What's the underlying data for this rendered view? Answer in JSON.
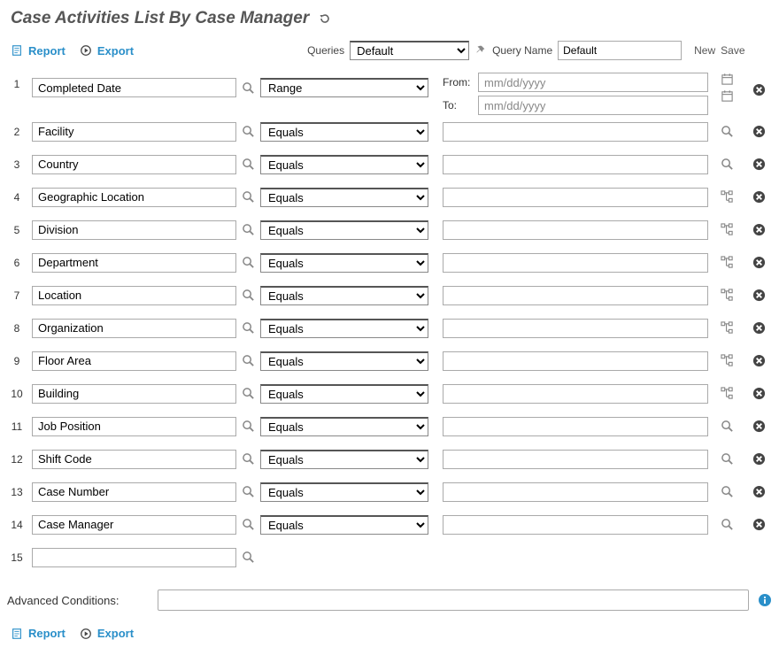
{
  "title": "Case Activities List By Case Manager",
  "toolbar": {
    "report": "Report",
    "export": "Export",
    "queries_label": "Queries",
    "query_selected": "Default",
    "query_name_label": "Query Name",
    "query_name_value": "Default",
    "new": "New",
    "save": "Save"
  },
  "range": {
    "from_label": "From:",
    "to_label": "To:",
    "from_value": "mm/dd/yyyy",
    "to_value": "mm/dd/yyyy"
  },
  "ops": {
    "range": "Range",
    "equals": "Equals"
  },
  "rows": [
    {
      "num": "1",
      "field": "Completed Date",
      "op": "Range",
      "val": "",
      "action": "none"
    },
    {
      "num": "2",
      "field": "Facility",
      "op": "Equals",
      "val": "",
      "action": "search"
    },
    {
      "num": "3",
      "field": "Country",
      "op": "Equals",
      "val": "",
      "action": "search"
    },
    {
      "num": "4",
      "field": "Geographic Location",
      "op": "Equals",
      "val": "",
      "action": "tree"
    },
    {
      "num": "5",
      "field": "Division",
      "op": "Equals",
      "val": "",
      "action": "tree"
    },
    {
      "num": "6",
      "field": "Department",
      "op": "Equals",
      "val": "",
      "action": "tree"
    },
    {
      "num": "7",
      "field": "Location",
      "op": "Equals",
      "val": "",
      "action": "tree"
    },
    {
      "num": "8",
      "field": "Organization",
      "op": "Equals",
      "val": "",
      "action": "tree"
    },
    {
      "num": "9",
      "field": "Floor Area",
      "op": "Equals",
      "val": "",
      "action": "tree"
    },
    {
      "num": "10",
      "field": "Building",
      "op": "Equals",
      "val": "",
      "action": "tree"
    },
    {
      "num": "11",
      "field": "Job Position",
      "op": "Equals",
      "val": "",
      "action": "search"
    },
    {
      "num": "12",
      "field": "Shift Code",
      "op": "Equals",
      "val": "",
      "action": "search"
    },
    {
      "num": "13",
      "field": "Case Number",
      "op": "Equals",
      "val": "",
      "action": "search"
    },
    {
      "num": "14",
      "field": "Case Manager",
      "op": "Equals",
      "val": "",
      "action": "search"
    },
    {
      "num": "15",
      "field": "",
      "op": "",
      "val": "",
      "action": "none",
      "noOp": true,
      "noDel": true
    }
  ],
  "advanced": {
    "label": "Advanced Conditions:",
    "value": ""
  }
}
